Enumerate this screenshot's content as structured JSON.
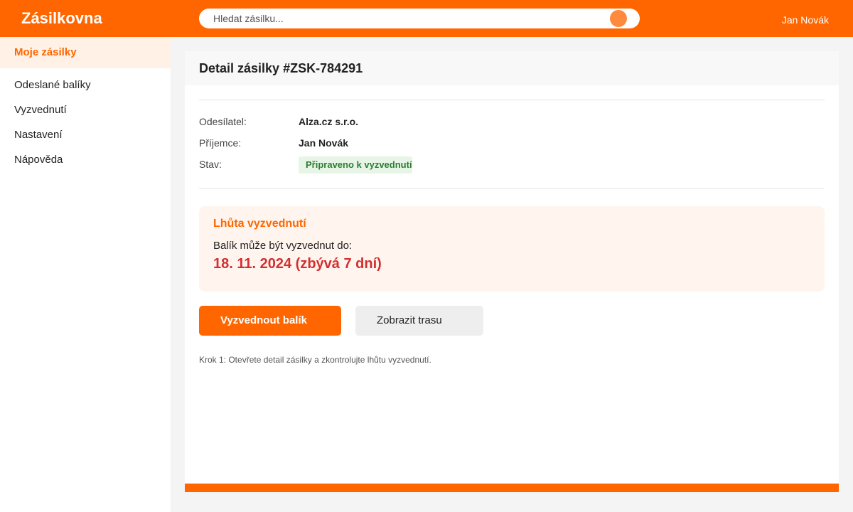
{
  "header": {
    "brand": "Zásilkovna",
    "search_placeholder": "Hledat zásilku...",
    "user_name": "Jan Novák",
    "accent_color": "#ff6600"
  },
  "sidebar": {
    "items": [
      {
        "label": "Moje zásilky",
        "active": true
      },
      {
        "label": "Odeslané balíky",
        "active": false
      },
      {
        "label": "Vyzvednutí",
        "active": false
      },
      {
        "label": "Nastavení",
        "active": false
      },
      {
        "label": "Nápověda",
        "active": false
      }
    ]
  },
  "detail": {
    "title": "Detail zásilky #ZSK-784291",
    "sender_label": "Odesílatel:",
    "sender_value": "Alza.cz s.r.o.",
    "recipient_label": "Příjemce:",
    "recipient_value": "Jan Novák",
    "status_label": "Stav:",
    "status_value": "Připraveno k vyzvednutí",
    "status_color": "#2e7d32"
  },
  "deadline": {
    "title": "Lhůta vyzvednutí",
    "text": "Balík může být vyzvednut do:",
    "date": "18. 11. 2024 (zbývá 7 dní)",
    "date_color": "#d32f2f"
  },
  "actions": {
    "primary_label": "Vyzvednout balík",
    "secondary_label": "Zobrazit trasu"
  },
  "hint": "Krok 1: Otevřete detail zásilky a zkontrolujte lhůtu vyzvednutí."
}
